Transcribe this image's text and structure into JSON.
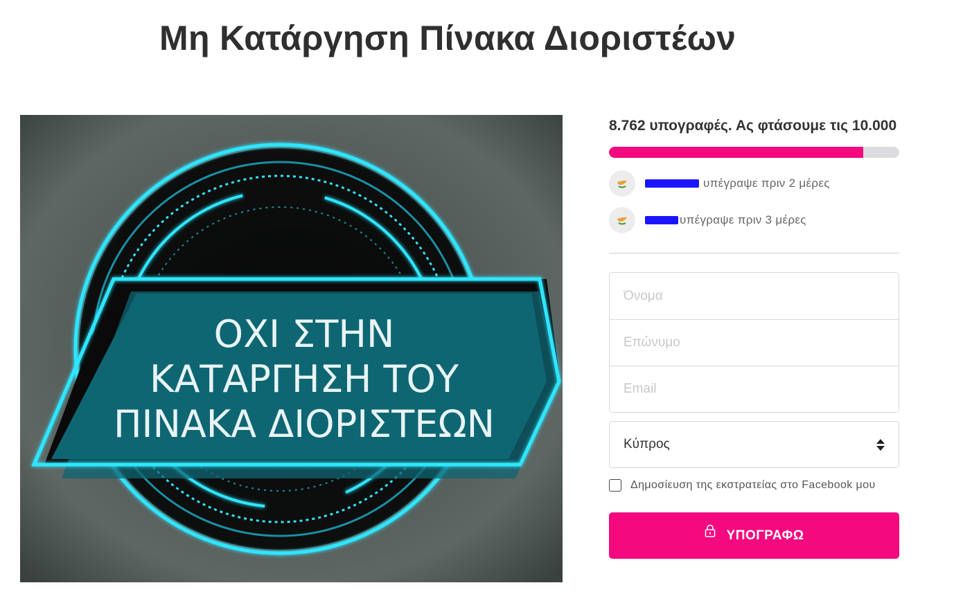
{
  "page": {
    "title": "Μη Κατάργηση Πίνακα Διοριστέων"
  },
  "campaign_image": {
    "lines": [
      "ΟΧΙ ΣΤΗΝ",
      "ΚΑΤΑΡΓΗΣΗ ΤΟΥ",
      "ΠΙΝΑΚΑ ΔΙΟΡΙΣΤΕΩΝ"
    ],
    "accent_color": "#2fe6ff",
    "banner_color": "#0f6673"
  },
  "sidebar": {
    "goal_text": "8.762 υπογραφές. Ας φτάσουμε τις 10.000",
    "progress_fraction": 0.8762,
    "progress_color": "#f4097e",
    "recent_signers": [
      {
        "flag": "cyprus-flag-icon",
        "text": "υπέγραψε πριν 2 μέρες"
      },
      {
        "flag": "cyprus-flag-icon",
        "text": "υπέγραψε πριν 3 μέρες"
      }
    ],
    "form": {
      "first_name_placeholder": "Όνομα",
      "last_name_placeholder": "Επώνυμο",
      "email_placeholder": "Email",
      "country_value": "Κύπρος",
      "facebook_label": "Δημοσίευση της εκστρατείας στο Facebook μου",
      "submit_label": "ΥΠΟΓΡΑΦΩ"
    }
  }
}
